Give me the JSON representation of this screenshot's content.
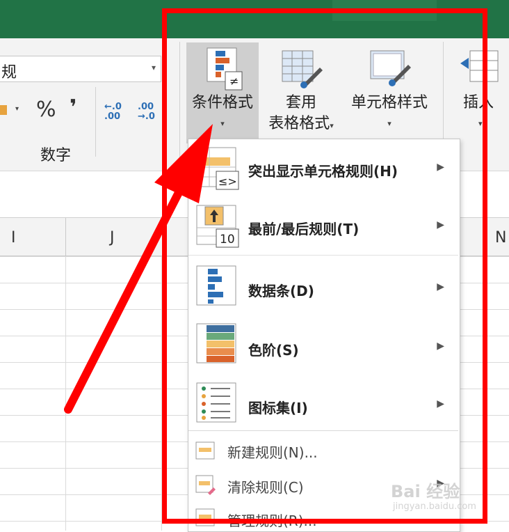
{
  "ribbon": {
    "number_format_value": "规",
    "percent_symbol": "%",
    "comma_symbol": "❜",
    "dec_increase": [
      "←.0",
      ".00"
    ],
    "dec_decrease": [
      ".00",
      "→.0"
    ],
    "group_number_label": "数字",
    "conditional_formatting": "条件格式",
    "format_as_table_line1": "套用",
    "format_as_table_line2": "表格格式",
    "cell_styles": "单元格样式",
    "insert": "插入",
    "dropdown_glyph": "▾"
  },
  "columns": [
    "I",
    "J",
    "N"
  ],
  "menu": {
    "items": [
      {
        "label": "突出显示单元格规则(H)",
        "icon": "highlight-cells-icon",
        "submenu": "▶"
      },
      {
        "label": "最前/最后规则(T)",
        "icon": "top-bottom-icon",
        "submenu": "▶"
      },
      {
        "label": "数据条(D)",
        "icon": "data-bars-icon",
        "submenu": "▶"
      },
      {
        "label": "色阶(S)",
        "icon": "color-scales-icon",
        "submenu": "▶"
      },
      {
        "label": "图标集(I)",
        "icon": "icon-sets-icon",
        "submenu": "▶"
      }
    ],
    "actions": [
      {
        "label": "新建规则(N)...",
        "icon": "new-rule-icon"
      },
      {
        "label": "清除规则(C)",
        "icon": "clear-rules-icon"
      },
      {
        "label": "管理规则(R)...",
        "icon": "manage-rules-icon"
      }
    ],
    "icon_badges": {
      "highlight": "≤>",
      "top": "10",
      "cf": "≠"
    }
  },
  "watermark": {
    "text": "Bai 经验",
    "url": "jingyan.baidu.com"
  },
  "colors": {
    "title_green": "#217346",
    "annotation_red": "#ff0000",
    "accent_orange": "#e7a33e",
    "accent_blue": "#2d6fb5"
  }
}
